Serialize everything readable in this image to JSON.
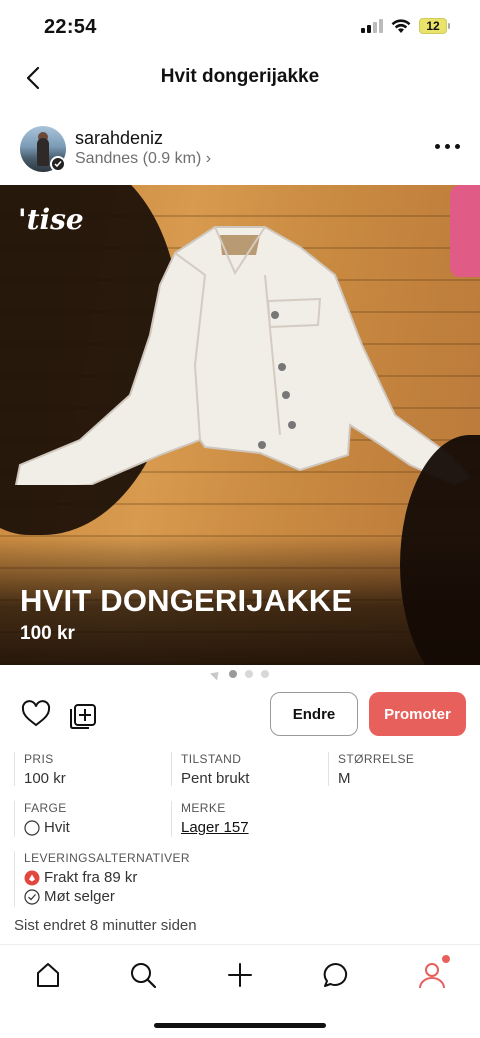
{
  "status_bar": {
    "time": "22:54",
    "battery_level": "12"
  },
  "header": {
    "title": "Hvit dongerijakke"
  },
  "seller": {
    "username": "sarahdeniz",
    "location": "Sandnes (0.9 km)",
    "location_chevron": "›"
  },
  "listing": {
    "brand_overlay": "'tise",
    "title": "HVIT DONGERIJAKKE",
    "price": "100 kr"
  },
  "carousel": {
    "count": 3,
    "active_index": 0
  },
  "actions": {
    "edit_label": "Endre",
    "promote_label": "Promoter"
  },
  "attributes": {
    "price": {
      "label": "PRIS",
      "value": "100 kr"
    },
    "condition": {
      "label": "TILSTAND",
      "value": "Pent brukt"
    },
    "size": {
      "label": "STØRRELSE",
      "value": "M"
    },
    "color": {
      "label": "FARGE",
      "value": "Hvit",
      "swatch": "#ffffff"
    },
    "brand": {
      "label": "MERKE",
      "value": "Lager 157"
    }
  },
  "delivery": {
    "label": "LEVERINGSALTERNATIVER",
    "shipping": "Frakt fra 89 kr",
    "meetup": "Møt selger"
  },
  "updated_text": "Sist endret 8 minutter siden",
  "colors": {
    "accent": "#e8605c",
    "text": "#111111",
    "muted": "#6f6f6f"
  },
  "tab_bar": {
    "items": [
      "home-icon",
      "search-icon",
      "plus-icon",
      "chat-icon",
      "profile-icon"
    ],
    "profile_has_notification": true
  }
}
